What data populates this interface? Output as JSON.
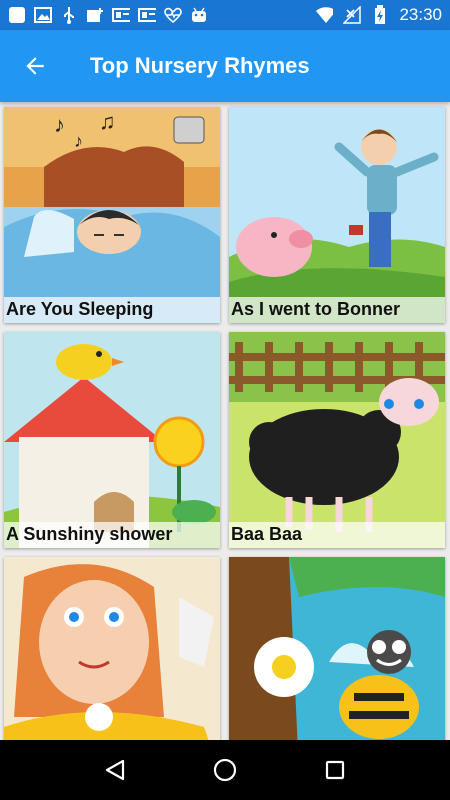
{
  "status_bar": {
    "time": "23:30",
    "left_icons": [
      "app-square-icon",
      "image-icon",
      "usb-icon",
      "add-photo-icon",
      "sim-icon",
      "sim-icon",
      "heart-monitor-icon",
      "android-icon"
    ],
    "right_icons": [
      "wifi-icon",
      "no-signal-icon",
      "battery-charging-icon"
    ]
  },
  "app_bar": {
    "title": "Top Nursery Rhymes",
    "back_icon": "arrow-left-icon",
    "color": "#2196f3"
  },
  "rhymes": [
    {
      "title": "Are You Sleeping"
    },
    {
      "title": "As I went to Bonner"
    },
    {
      "title": "A Sunshiny shower"
    },
    {
      "title": "Baa Baa"
    },
    {
      "title": ""
    },
    {
      "title": ""
    }
  ],
  "nav_bar": {
    "icons": [
      "back-triangle-icon",
      "home-circle-icon",
      "recents-square-icon"
    ]
  }
}
